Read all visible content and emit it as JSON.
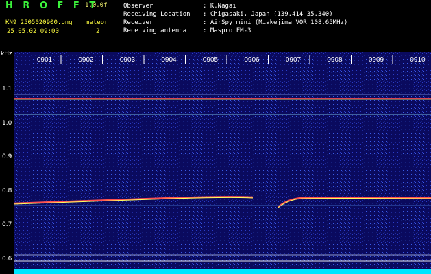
{
  "header": {
    "brand": "H R O F F T",
    "version": "1.0.0f",
    "file_name": "KN9_2505020900.png",
    "datetime": "25.05.02 09:00",
    "meteor_label": "meteor",
    "meteor_count": "2"
  },
  "info": {
    "rows": [
      {
        "label": "Observer",
        "value": ": K.Nagai"
      },
      {
        "label": "Receiving Location",
        "value": ": Chigasaki, Japan (139.414 35.340)"
      },
      {
        "label": "Receiver",
        "value": ": AirSpy mini (Miakejima VOR 108.65MHz)"
      },
      {
        "label": "Receiving antenna",
        "value": ": Maspro FM-3"
      }
    ]
  },
  "axes": {
    "y_unit": "kHz",
    "y_ticks": [
      "1.1",
      "1.0",
      "0.9",
      "0.8",
      "0.7",
      "0.6"
    ],
    "x_ticks": [
      "0901",
      "0902",
      "0903",
      "0904",
      "0905",
      "0906",
      "0907",
      "0908",
      "0909",
      "0910"
    ]
  },
  "colors": {
    "background": "#000000",
    "spectrum_base": "#0a0a5e",
    "signal_red": "#ff4040",
    "signal_yellow": "#ffff60",
    "baseline_cyan": "#00e5ff",
    "header_green": "#3cf23c",
    "header_yellow": "#ffff40"
  }
}
